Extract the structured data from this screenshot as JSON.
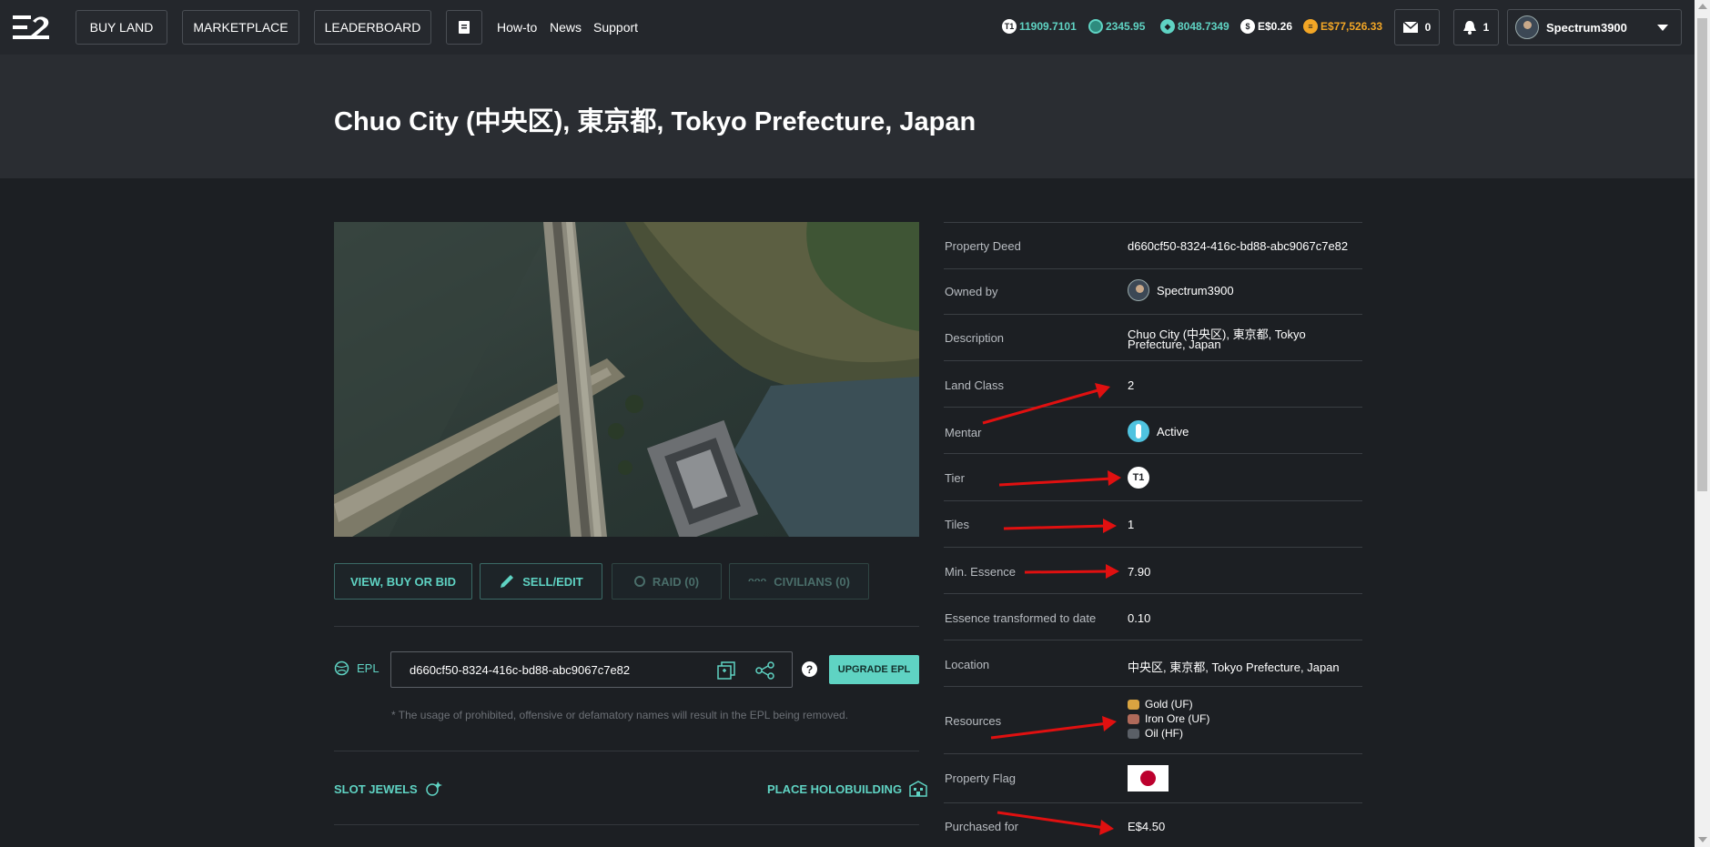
{
  "nav": {
    "buy_land": "BUY LAND",
    "marketplace": "MARKETPLACE",
    "leaderboard": "LEADERBOARD",
    "howto": "How-to",
    "news": "News",
    "support": "Support"
  },
  "balances": {
    "t1": "11909.7101",
    "gem": "2345.95",
    "essence": "8048.7349",
    "usd": "E$0.26",
    "gold": "E$77,526.33"
  },
  "notifications": {
    "mail_count": "0",
    "bell_count": "1"
  },
  "user": {
    "name": "Spectrum3900"
  },
  "page": {
    "title": "Chuo City (中央区), 東京都, Tokyo Prefecture, Japan"
  },
  "actions": {
    "view_buy_bid": "VIEW, BUY OR BID",
    "sell_edit": "SELL/EDIT",
    "raid": "RAID (0)",
    "civilians": "CIVILIANS (0)"
  },
  "epl": {
    "label": "EPL",
    "value": "d660cf50-8324-416c-bd88-abc9067c7e82",
    "help": "?",
    "upgrade": "UPGRADE EPL",
    "disclaimer": "* The usage of prohibited, offensive or defamatory names will result in the EPL being removed."
  },
  "extras": {
    "slot_jewels": "SLOT JEWELS",
    "place_holobuilding": "PLACE HOLOBUILDING"
  },
  "property": {
    "deed_label": "Property Deed",
    "deed": "d660cf50-8324-416c-bd88-abc9067c7e82",
    "owned_label": "Owned by",
    "owner": "Spectrum3900",
    "desc_label": "Description",
    "desc_line1": "Chuo City (中央区), 東京都, Tokyo",
    "desc_line2": "Prefecture, Japan",
    "class_label": "Land Class",
    "class": "2",
    "mentar_label": "Mentar",
    "mentar": "Active",
    "tier_label": "Tier",
    "tier": "T1",
    "tiles_label": "Tiles",
    "tiles": "1",
    "minessence_label": "Min. Essence",
    "minessence": "7.90",
    "transformed_label": "Essence transformed to date",
    "transformed": "0.10",
    "location_label": "Location",
    "location": "中央区, 東京都, Tokyo Prefecture, Japan",
    "resources_label": "Resources",
    "resources": [
      "Gold (UF)",
      "Iron Ore (UF)",
      "Oil (HF)"
    ],
    "flag_label": "Property Flag",
    "purchased_label": "Purchased for",
    "purchased": "E$4.50"
  },
  "colors": {
    "accent": "#5fd3c3",
    "arrow": "#e01010",
    "bg": "#1c1f23"
  }
}
